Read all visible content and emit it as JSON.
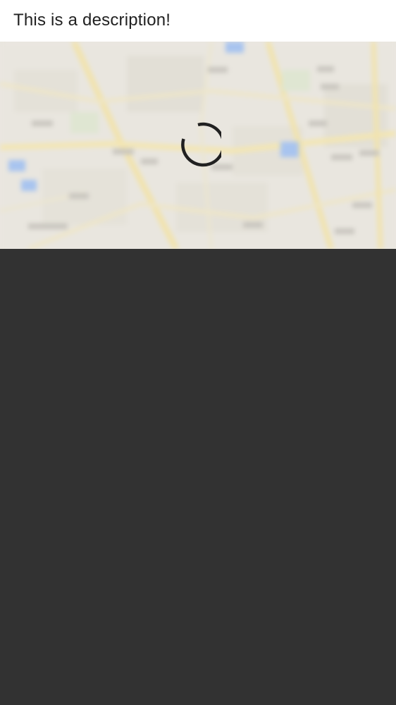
{
  "header": {
    "description": "This is a description!"
  },
  "map": {
    "state": "loading",
    "icon": "loading-spinner-icon"
  },
  "colors": {
    "header_bg": "#ffffff",
    "text": "#212121",
    "map_base": "#e9e6df",
    "map_roads": "#f3e3a6",
    "map_water": "#a8c8f0",
    "spinner": "#212121",
    "background": "#323232"
  }
}
